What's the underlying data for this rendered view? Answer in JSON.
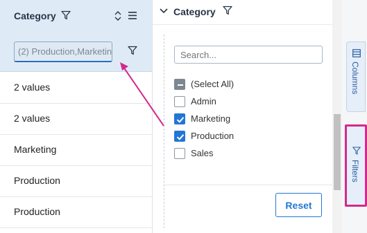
{
  "grid": {
    "column_title": "Category",
    "floating_filter_value": "(2) Production,Marketing",
    "rows": [
      "2 values",
      "2 values",
      "Marketing",
      "Production",
      "Production"
    ]
  },
  "filter_panel": {
    "title": "Category",
    "search_placeholder": "Search...",
    "options": [
      {
        "label": "(Select All)",
        "state": "indeterminate"
      },
      {
        "label": "Admin",
        "state": "unchecked"
      },
      {
        "label": "Marketing",
        "state": "checked"
      },
      {
        "label": "Production",
        "state": "checked"
      },
      {
        "label": "Sales",
        "state": "unchecked"
      }
    ],
    "reset_label": "Reset"
  },
  "side_bar": {
    "columns_label": "Columns",
    "filters_label": "Filters"
  },
  "colors": {
    "accent": "#2277d4",
    "header_bg": "#deebf7",
    "annotation": "#d4288f"
  },
  "icons": {
    "filter": "funnel-icon",
    "sort": "sort-icon",
    "menu": "hamburger-menu-icon",
    "collapse": "chevron-down-icon",
    "columns": "columns-icon"
  }
}
